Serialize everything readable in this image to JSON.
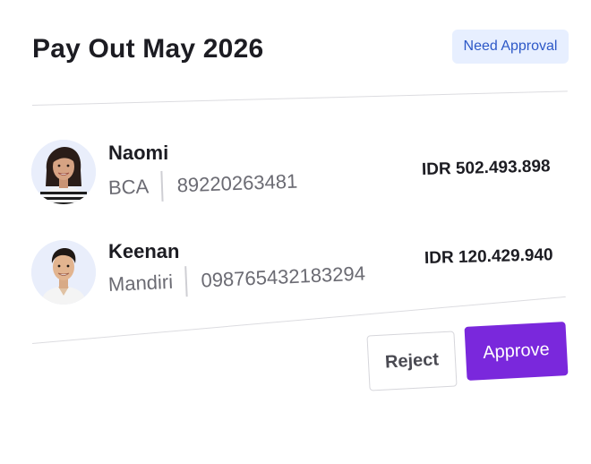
{
  "header": {
    "title": "Pay Out May 2026",
    "status_badge": "Need Approval"
  },
  "payouts": [
    {
      "name": "Naomi",
      "bank": "BCA",
      "account_number": "89220263481",
      "amount": "IDR 502.493.898"
    },
    {
      "name": "Keenan",
      "bank": "Mandiri",
      "account_number": "098765432183294",
      "amount": "IDR 120.429.940"
    }
  ],
  "actions": {
    "reject_label": "Reject",
    "approve_label": "Approve"
  },
  "colors": {
    "accent": "#7a28dc",
    "badge_bg": "#e7efff",
    "badge_text": "#2d58c7"
  }
}
